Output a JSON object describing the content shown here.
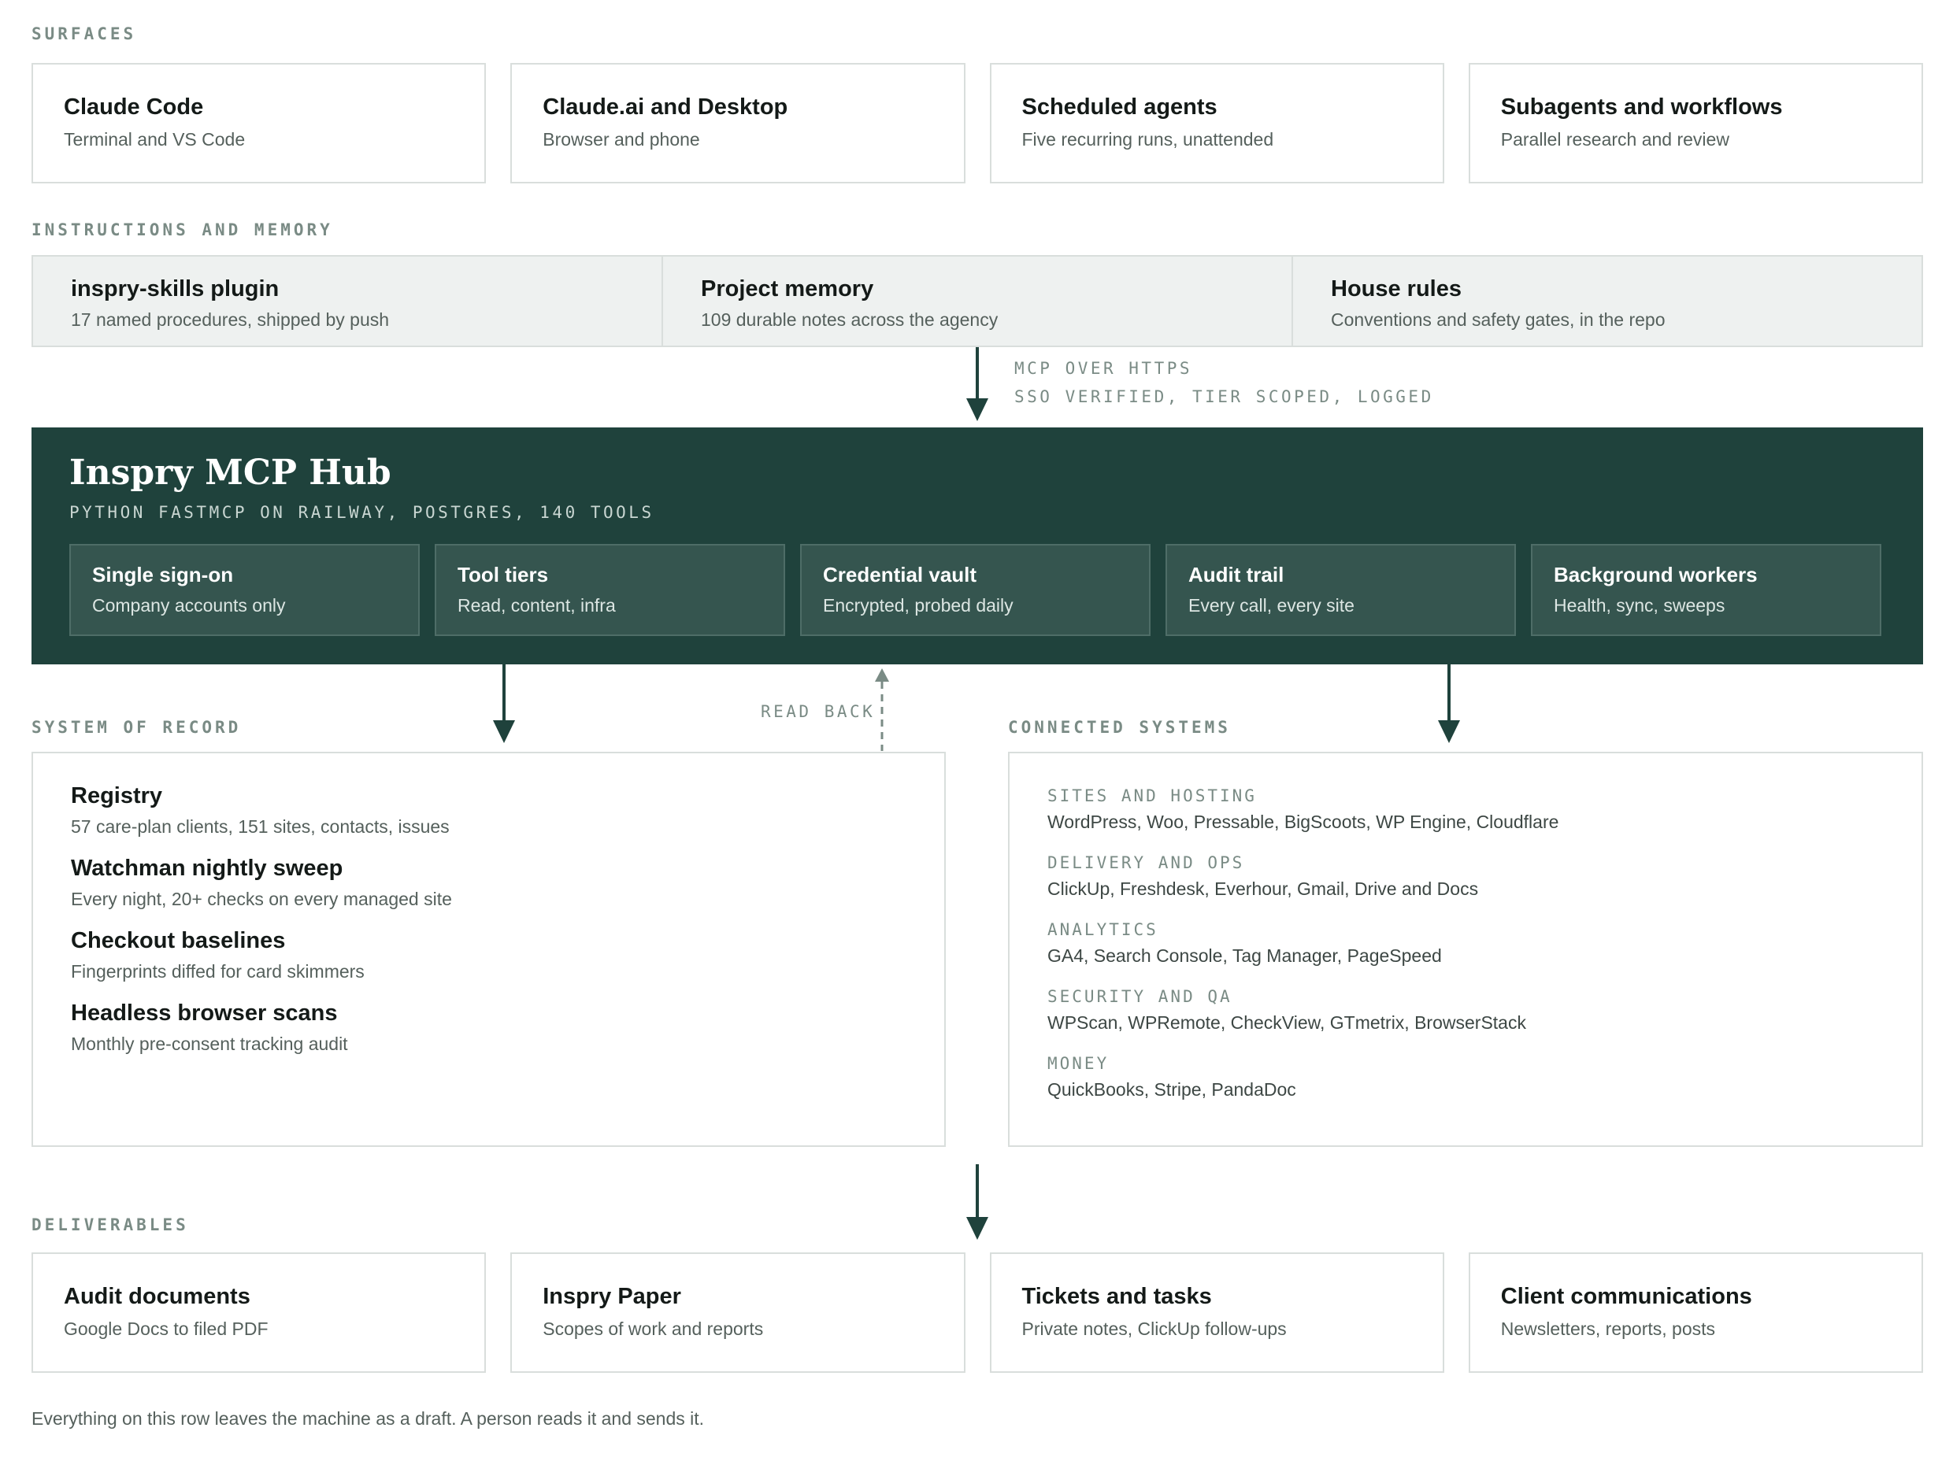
{
  "surfaces": {
    "label": "SURFACES",
    "cards": [
      {
        "title": "Claude Code",
        "sub": "Terminal and VS Code"
      },
      {
        "title": "Claude.ai and Desktop",
        "sub": "Browser and phone"
      },
      {
        "title": "Scheduled agents",
        "sub": "Five recurring runs, unattended"
      },
      {
        "title": "Subagents and workflows",
        "sub": "Parallel research and review"
      }
    ]
  },
  "instructions": {
    "label": "INSTRUCTIONS AND MEMORY",
    "cells": [
      {
        "title": "inspry-skills plugin",
        "sub": "17 named procedures, shipped by push"
      },
      {
        "title": "Project memory",
        "sub": "109 durable notes across the agency"
      },
      {
        "title": "House rules",
        "sub": "Conventions and safety gates, in the repo"
      }
    ]
  },
  "transport": {
    "line1": "MCP OVER HTTPS",
    "line2": "SSO VERIFIED, TIER SCOPED, LOGGED"
  },
  "hub": {
    "title": "Inspry MCP Hub",
    "subtitle": "PYTHON FASTMCP ON RAILWAY, POSTGRES, 140 TOOLS",
    "features": [
      {
        "title": "Single sign-on",
        "sub": "Company accounts only"
      },
      {
        "title": "Tool tiers",
        "sub": "Read, content, infra"
      },
      {
        "title": "Credential vault",
        "sub": "Encrypted, probed daily"
      },
      {
        "title": "Audit trail",
        "sub": "Every call, every site"
      },
      {
        "title": "Background workers",
        "sub": "Health, sync, sweeps"
      }
    ]
  },
  "read_back": "READ BACK",
  "system_of_record": {
    "label": "SYSTEM OF RECORD",
    "items": [
      {
        "title": "Registry",
        "sub": "57 care-plan clients, 151 sites, contacts, issues"
      },
      {
        "title": "Watchman nightly sweep",
        "sub": "Every night, 20+ checks on every managed site"
      },
      {
        "title": "Checkout baselines",
        "sub": "Fingerprints diffed for card skimmers"
      },
      {
        "title": "Headless browser scans",
        "sub": "Monthly pre-consent tracking audit"
      }
    ]
  },
  "connected_systems": {
    "label": "CONNECTED SYSTEMS",
    "groups": [
      {
        "label": "SITES AND HOSTING",
        "items": "WordPress, Woo, Pressable, BigScoots, WP Engine, Cloudflare"
      },
      {
        "label": "DELIVERY AND OPS",
        "items": "ClickUp, Freshdesk, Everhour, Gmail, Drive and Docs"
      },
      {
        "label": "ANALYTICS",
        "items": "GA4, Search Console, Tag Manager, PageSpeed"
      },
      {
        "label": "SECURITY AND QA",
        "items": "WPScan, WPRemote, CheckView, GTmetrix, BrowserStack"
      },
      {
        "label": "MONEY",
        "items": "QuickBooks, Stripe, PandaDoc"
      }
    ]
  },
  "deliverables": {
    "label": "DELIVERABLES",
    "cards": [
      {
        "title": "Audit documents",
        "sub": "Google Docs to filed PDF"
      },
      {
        "title": "Inspry Paper",
        "sub": "Scopes of work and reports"
      },
      {
        "title": "Tickets and tasks",
        "sub": "Private notes, ClickUp follow-ups"
      },
      {
        "title": "Client communications",
        "sub": "Newsletters, reports, posts"
      }
    ],
    "note": "Everything on this row leaves the machine as a draft. A person reads it and sends it."
  },
  "colors": {
    "hub_bg": "#1f423c",
    "feature_bg": "#35554f",
    "band_bg": "#eef1f0",
    "label_gray": "#7a8b85",
    "border": "#d9dedc"
  }
}
